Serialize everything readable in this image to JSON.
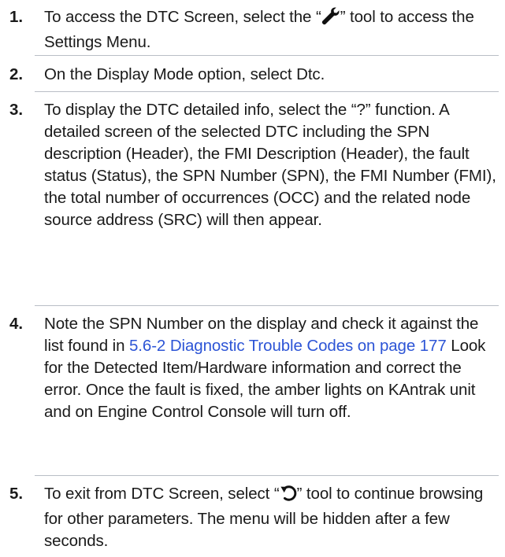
{
  "steps": [
    {
      "number": "1.",
      "before_icon": "To access the DTC Screen, select the “",
      "icon": "wrench-icon",
      "after_icon": "” tool to access the Settings Menu."
    },
    {
      "number": "2.",
      "text": "On the Display Mode option, select Dtc."
    },
    {
      "number": "3.",
      "text": "To display the DTC detailed info, select the “?” function. A detailed screen of the selected DTC including the SPN description (Header), the FMI Description (Header), the fault status (Status), the SPN Number (SPN), the FMI Number (FMI), the total number of occurrences (OCC) and the related node source address (SRC) will then appear."
    },
    {
      "number": "4.",
      "before_link": "Note the SPN Number on the display and check it against the list found in ",
      "link": "5.6-2 Diagnostic Trouble Codes on page 177",
      "after_link": " Look for the Detected Item/Hardware information and correct the error. Once the fault is fixed, the amber lights on KAntrak unit and on Engine Control Console will turn off."
    },
    {
      "number": "5.",
      "before_icon": "To exit from DTC Screen, select “",
      "icon": "back-arrow-icon",
      "after_icon": "” tool to continue browsing for other parameters. The menu will be hidden after a few seconds."
    }
  ],
  "colors": {
    "text": "#1a1a1a",
    "link": "#2d55d6",
    "separator": "#b9bec6"
  }
}
